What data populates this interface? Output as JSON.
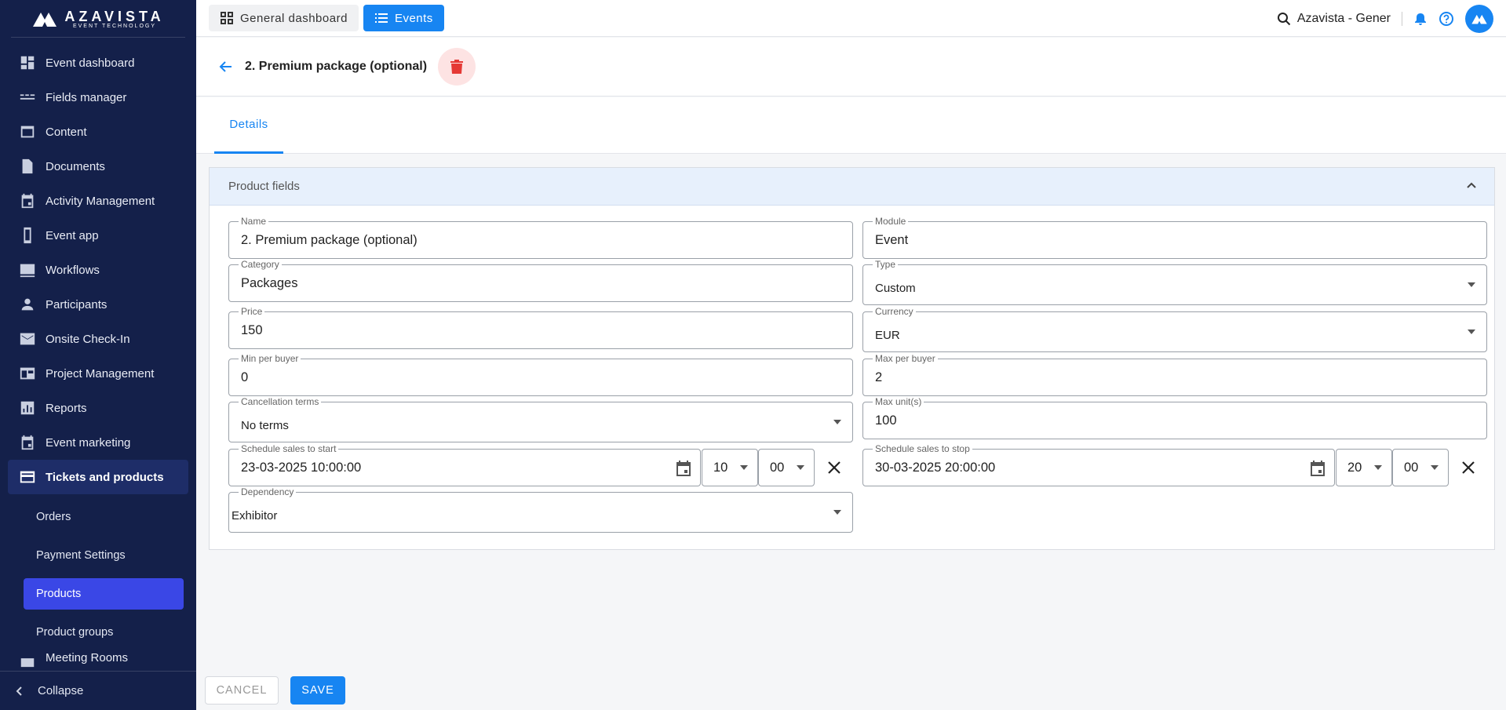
{
  "brand": {
    "name": "AZAVISTA",
    "tagline": "EVENT TECHNOLOGY"
  },
  "sidebar": {
    "items": [
      {
        "label": "Event dashboard",
        "icon": "dashboard-icon"
      },
      {
        "label": "Fields manager",
        "icon": "fields-icon"
      },
      {
        "label": "Content",
        "icon": "content-icon"
      },
      {
        "label": "Documents",
        "icon": "document-icon"
      },
      {
        "label": "Activity Management",
        "icon": "calendar-icon"
      },
      {
        "label": "Event app",
        "icon": "phone-icon"
      },
      {
        "label": "Workflows",
        "icon": "workflow-icon"
      },
      {
        "label": "Participants",
        "icon": "person-icon"
      },
      {
        "label": "Onsite Check-In",
        "icon": "mail-icon"
      },
      {
        "label": "Project Management",
        "icon": "project-icon"
      },
      {
        "label": "Reports",
        "icon": "reports-icon"
      },
      {
        "label": "Event marketing",
        "icon": "calendar-icon"
      },
      {
        "label": "Tickets and products",
        "icon": "card-icon"
      }
    ],
    "sub_items": [
      {
        "label": "Orders"
      },
      {
        "label": "Payment Settings"
      },
      {
        "label": "Products"
      },
      {
        "label": "Product groups"
      }
    ],
    "partial_item": "Meeting Rooms",
    "collapse_label": "Collapse"
  },
  "topbar": {
    "general_label": "General dashboard",
    "events_label": "Events",
    "account_label": "Azavista - Gener"
  },
  "page": {
    "title": "2. Premium package (optional)",
    "tab_details": "Details",
    "section_title": "Product fields"
  },
  "form": {
    "name": {
      "label": "Name",
      "value": "2. Premium package (optional)"
    },
    "module": {
      "label": "Module",
      "value": "Event"
    },
    "category": {
      "label": "Category",
      "value": "Packages"
    },
    "type": {
      "label": "Type",
      "value": "Custom"
    },
    "price": {
      "label": "Price",
      "value": "150"
    },
    "currency": {
      "label": "Currency",
      "value": "EUR"
    },
    "min_per_buyer": {
      "label": "Min per buyer",
      "value": "0"
    },
    "max_per_buyer": {
      "label": "Max per buyer",
      "value": "2"
    },
    "cancellation_terms": {
      "label": "Cancellation terms",
      "value": "No terms"
    },
    "max_units": {
      "label": "Max unit(s)",
      "value": "100"
    },
    "sales_start": {
      "label": "Schedule sales to start",
      "value": "23-03-2025 10:00:00",
      "hour": "10",
      "minute": "00"
    },
    "sales_stop": {
      "label": "Schedule sales to stop",
      "value": "30-03-2025 20:00:00",
      "hour": "20",
      "minute": "00"
    },
    "dependency": {
      "label": "Dependency",
      "value": "Exhibitor"
    }
  },
  "footer": {
    "cancel_label": "CANCEL",
    "save_label": "SAVE"
  },
  "colors": {
    "sidebar": "#14204a",
    "accent": "#1785f2",
    "active_sub": "#3a47e6",
    "delete": "#e53935"
  }
}
